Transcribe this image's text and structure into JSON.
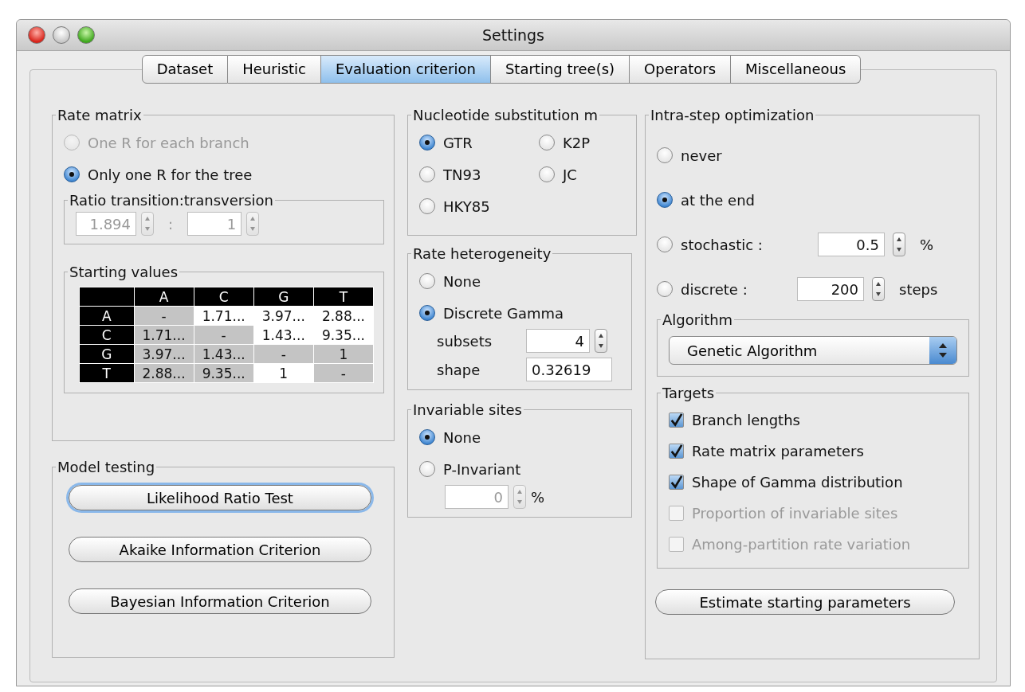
{
  "window": {
    "title": "Settings"
  },
  "tabs": [
    {
      "label": "Dataset",
      "selected": false
    },
    {
      "label": "Heuristic",
      "selected": false
    },
    {
      "label": "Evaluation criterion",
      "selected": true
    },
    {
      "label": "Starting tree(s)",
      "selected": false
    },
    {
      "label": "Operators",
      "selected": false
    },
    {
      "label": "Miscellaneous",
      "selected": false
    }
  ],
  "rate_matrix": {
    "title": "Rate matrix",
    "options": [
      {
        "label": "One R for each branch",
        "selected": false,
        "disabled": true
      },
      {
        "label": "Only one R for the tree",
        "selected": true,
        "disabled": false
      }
    ],
    "ratio": {
      "title": "Ratio transition:transversion",
      "value": "1.894",
      "separator": ":",
      "value_2": "1",
      "disabled": true
    }
  },
  "starting_values": {
    "title": "Starting values",
    "columns": [
      "A",
      "C",
      "G",
      "T"
    ],
    "rows": [
      {
        "header": "A",
        "cells": [
          {
            "text": "-",
            "shaded": true
          },
          {
            "text": "1.71...",
            "shaded": false
          },
          {
            "text": "3.97...",
            "shaded": false
          },
          {
            "text": "2.88...",
            "shaded": false
          }
        ]
      },
      {
        "header": "C",
        "cells": [
          {
            "text": "1.71...",
            "shaded": true
          },
          {
            "text": "-",
            "shaded": true
          },
          {
            "text": "1.43...",
            "shaded": false
          },
          {
            "text": "9.35...",
            "shaded": false
          }
        ]
      },
      {
        "header": "G",
        "cells": [
          {
            "text": "3.97...",
            "shaded": true
          },
          {
            "text": "1.43...",
            "shaded": true
          },
          {
            "text": "-",
            "shaded": true
          },
          {
            "text": "1",
            "shaded": true
          }
        ]
      },
      {
        "header": "T",
        "cells": [
          {
            "text": "2.88...",
            "shaded": true
          },
          {
            "text": "9.35...",
            "shaded": true
          },
          {
            "text": "1",
            "shaded": false
          },
          {
            "text": "-",
            "shaded": true
          }
        ]
      }
    ]
  },
  "model_testing": {
    "title": "Model testing",
    "buttons": [
      {
        "label": "Likelihood Ratio Test",
        "focused": true
      },
      {
        "label": "Akaike Information Criterion",
        "focused": false
      },
      {
        "label": "Bayesian Information Criterion",
        "focused": false
      }
    ]
  },
  "nucleotide_substitution": {
    "title": "Nucleotide substitution m",
    "options": [
      {
        "label": "GTR",
        "selected": true
      },
      {
        "label": "K2P",
        "selected": false
      },
      {
        "label": "TN93",
        "selected": false
      },
      {
        "label": "JC",
        "selected": false
      },
      {
        "label": "HKY85",
        "selected": false
      }
    ]
  },
  "rate_heterogeneity": {
    "title": "Rate heterogeneity",
    "options": [
      {
        "label": "None",
        "selected": false
      },
      {
        "label": "Discrete Gamma",
        "selected": true
      }
    ],
    "subsets": {
      "label": "subsets",
      "value": "4"
    },
    "shape": {
      "label": "shape",
      "value": "0.32619"
    }
  },
  "invariable_sites": {
    "title": "Invariable sites",
    "options": [
      {
        "label": "None",
        "selected": true
      },
      {
        "label": "P-Invariant",
        "selected": false
      }
    ],
    "field": {
      "value": "0",
      "unit": "%",
      "disabled": true
    }
  },
  "intra_step_optimization": {
    "title": "Intra-step optimization",
    "options": [
      {
        "kind": "plain",
        "label": "never",
        "selected": false
      },
      {
        "kind": "plain",
        "label": "at the end",
        "selected": true
      },
      {
        "kind": "field",
        "label": "stochastic :",
        "selected": false,
        "value": "0.5",
        "unit": "%"
      },
      {
        "kind": "field",
        "label": "discrete :",
        "selected": false,
        "value": "200",
        "unit": "steps"
      }
    ],
    "algorithm": {
      "title": "Algorithm",
      "value": "Genetic Algorithm"
    },
    "targets": {
      "title": "Targets",
      "items": [
        {
          "label": "Branch lengths",
          "checked": true,
          "disabled": false
        },
        {
          "label": "Rate matrix parameters",
          "checked": true,
          "disabled": false
        },
        {
          "label": "Shape of Gamma distribution",
          "checked": true,
          "disabled": false
        },
        {
          "label": "Proportion of invariable sites",
          "checked": false,
          "disabled": true
        },
        {
          "label": "Among-partition rate variation",
          "checked": false,
          "disabled": true
        }
      ]
    },
    "button": {
      "label": "Estimate starting parameters"
    }
  }
}
